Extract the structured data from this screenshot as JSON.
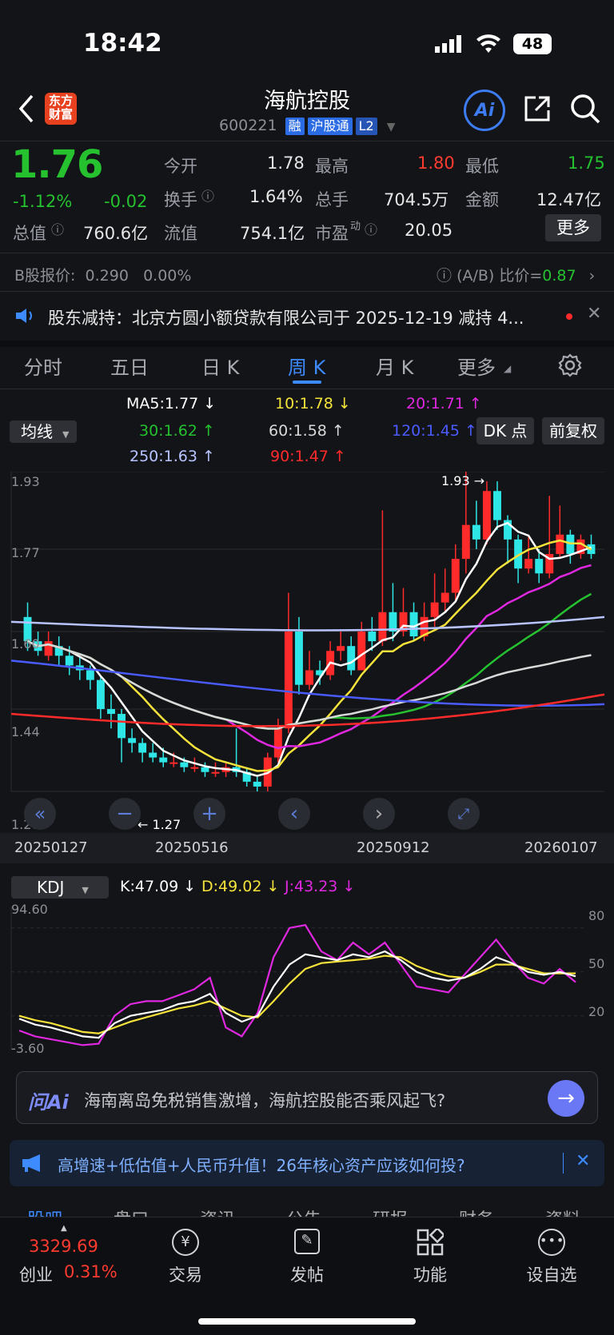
{
  "status_bar": {
    "time": "18:42",
    "battery": "48"
  },
  "header": {
    "logo_text": [
      "东方",
      "财富"
    ],
    "stock_name": "海航控股",
    "stock_code": "600221",
    "tags": [
      "融",
      "沪股通",
      "L2"
    ],
    "ai_label": "Ai"
  },
  "quote": {
    "price": "1.76",
    "change_pct": "-1.12%",
    "change": "-0.02",
    "fields": {
      "open_label": "今开",
      "open": "1.78",
      "high_label": "最高",
      "high": "1.80",
      "low_label": "最低",
      "low": "1.75",
      "turnover_label": "换手",
      "turnover": "1.64%",
      "volume_label": "总手",
      "volume": "704.5万",
      "amount_label": "金额",
      "amount": "12.47亿",
      "total_cap_label": "总值",
      "total_cap": "760.6亿",
      "float_cap_label": "流值",
      "float_cap": "754.1亿",
      "pe_label": "市盈",
      "pe_sup": "动",
      "pe": "20.05"
    },
    "more_label": "更多",
    "b_share_label": "B股报价:",
    "b_share_price": "0.290",
    "b_share_pct": "0.00%",
    "ab_ratio_label": "(A/B) 比价=",
    "ab_ratio": "0.87"
  },
  "announcement": {
    "text": "股东减持：北京方圆小额贷款有限公司于 2025-12-19 减持 4..."
  },
  "tabs": [
    {
      "label": "分时"
    },
    {
      "label": "五日"
    },
    {
      "label": "日 K"
    },
    {
      "label": "周 K"
    },
    {
      "label": "月 K"
    },
    {
      "label": "更多"
    }
  ],
  "legend": {
    "ma_select": "均线",
    "ma5": "MA5:1.77 ↓",
    "ma10": "10:1.78 ↓",
    "ma20": "20:1.71 ↑",
    "ma30": "30:1.62 ↑",
    "ma60": "60:1.58 ↑",
    "ma120": "120:1.45 ↑",
    "ma250": "250:1.63 ↑",
    "ma90": "90:1.47 ↑",
    "dk_btn": "DK 点",
    "fq_btn": "前复权",
    "colors": {
      "ma5": "#ffffff",
      "ma10": "#f5e33b",
      "ma20": "#e028e0",
      "ma30": "#25c12f",
      "ma60": "#d9d9d9",
      "ma120": "#4a5bff",
      "ma250": "#b8c4ff",
      "ma90": "#ff2b2b"
    }
  },
  "chart_data": [
    {
      "type": "candlestick",
      "title": "",
      "y_ticks": [
        "1.93",
        "1.77",
        "1.60",
        "1.44",
        "1.27"
      ],
      "ylim": [
        1.27,
        1.93
      ],
      "x_ticks": [
        "20250127",
        "20250516",
        "20250912",
        "20260107"
      ],
      "annotations": {
        "max": "1.93",
        "min": "1.27"
      },
      "candles": [
        {
          "o": 1.63,
          "c": 1.58,
          "h": 1.66,
          "l": 1.56
        },
        {
          "o": 1.58,
          "c": 1.56,
          "h": 1.6,
          "l": 1.55
        },
        {
          "o": 1.55,
          "c": 1.58,
          "h": 1.6,
          "l": 1.54
        },
        {
          "o": 1.57,
          "c": 1.55,
          "h": 1.59,
          "l": 1.53
        },
        {
          "o": 1.55,
          "c": 1.53,
          "h": 1.57,
          "l": 1.51
        },
        {
          "o": 1.53,
          "c": 1.52,
          "h": 1.55,
          "l": 1.5
        },
        {
          "o": 1.52,
          "c": 1.5,
          "h": 1.53,
          "l": 1.48
        },
        {
          "o": 1.5,
          "c": 1.44,
          "h": 1.51,
          "l": 1.42
        },
        {
          "o": 1.44,
          "c": 1.43,
          "h": 1.47,
          "l": 1.4
        },
        {
          "o": 1.43,
          "c": 1.38,
          "h": 1.44,
          "l": 1.33
        },
        {
          "o": 1.38,
          "c": 1.37,
          "h": 1.4,
          "l": 1.35
        },
        {
          "o": 1.37,
          "c": 1.35,
          "h": 1.38,
          "l": 1.33
        },
        {
          "o": 1.35,
          "c": 1.34,
          "h": 1.37,
          "l": 1.33
        },
        {
          "o": 1.34,
          "c": 1.33,
          "h": 1.36,
          "l": 1.32
        },
        {
          "o": 1.33,
          "c": 1.33,
          "h": 1.35,
          "l": 1.32
        },
        {
          "o": 1.33,
          "c": 1.32,
          "h": 1.34,
          "l": 1.31
        },
        {
          "o": 1.32,
          "c": 1.32,
          "h": 1.34,
          "l": 1.31
        },
        {
          "o": 1.32,
          "c": 1.31,
          "h": 1.33,
          "l": 1.3
        },
        {
          "o": 1.31,
          "c": 1.31,
          "h": 1.33,
          "l": 1.3
        },
        {
          "o": 1.31,
          "c": 1.32,
          "h": 1.33,
          "l": 1.3
        },
        {
          "o": 1.32,
          "c": 1.31,
          "h": 1.4,
          "l": 1.3
        },
        {
          "o": 1.31,
          "c": 1.29,
          "h": 1.32,
          "l": 1.28
        },
        {
          "o": 1.29,
          "c": 1.28,
          "h": 1.3,
          "l": 1.27
        },
        {
          "o": 1.28,
          "c": 1.34,
          "h": 1.35,
          "l": 1.27
        },
        {
          "o": 1.34,
          "c": 1.4,
          "h": 1.42,
          "l": 1.33
        },
        {
          "o": 1.4,
          "c": 1.6,
          "h": 1.68,
          "l": 1.39
        },
        {
          "o": 1.6,
          "c": 1.49,
          "h": 1.63,
          "l": 1.47
        },
        {
          "o": 1.49,
          "c": 1.52,
          "h": 1.56,
          "l": 1.48
        },
        {
          "o": 1.52,
          "c": 1.51,
          "h": 1.54,
          "l": 1.49
        },
        {
          "o": 1.51,
          "c": 1.56,
          "h": 1.58,
          "l": 1.5
        },
        {
          "o": 1.56,
          "c": 1.57,
          "h": 1.6,
          "l": 1.54
        },
        {
          "o": 1.57,
          "c": 1.52,
          "h": 1.59,
          "l": 1.51
        },
        {
          "o": 1.52,
          "c": 1.6,
          "h": 1.62,
          "l": 1.52
        },
        {
          "o": 1.6,
          "c": 1.58,
          "h": 1.63,
          "l": 1.56
        },
        {
          "o": 1.58,
          "c": 1.64,
          "h": 1.85,
          "l": 1.57
        },
        {
          "o": 1.64,
          "c": 1.6,
          "h": 1.7,
          "l": 1.58
        },
        {
          "o": 1.6,
          "c": 1.64,
          "h": 1.69,
          "l": 1.59
        },
        {
          "o": 1.64,
          "c": 1.59,
          "h": 1.66,
          "l": 1.58
        },
        {
          "o": 1.59,
          "c": 1.63,
          "h": 1.66,
          "l": 1.58
        },
        {
          "o": 1.63,
          "c": 1.66,
          "h": 1.72,
          "l": 1.61
        },
        {
          "o": 1.66,
          "c": 1.68,
          "h": 1.73,
          "l": 1.64
        },
        {
          "o": 1.68,
          "c": 1.75,
          "h": 1.78,
          "l": 1.66
        },
        {
          "o": 1.75,
          "c": 1.82,
          "h": 1.93,
          "l": 1.72
        },
        {
          "o": 1.82,
          "c": 1.79,
          "h": 1.87,
          "l": 1.77
        },
        {
          "o": 1.79,
          "c": 1.89,
          "h": 1.91,
          "l": 1.78
        },
        {
          "o": 1.89,
          "c": 1.83,
          "h": 1.91,
          "l": 1.81
        },
        {
          "o": 1.83,
          "c": 1.79,
          "h": 1.84,
          "l": 1.74
        },
        {
          "o": 1.79,
          "c": 1.73,
          "h": 1.8,
          "l": 1.7
        },
        {
          "o": 1.73,
          "c": 1.75,
          "h": 1.8,
          "l": 1.72
        },
        {
          "o": 1.75,
          "c": 1.72,
          "h": 1.77,
          "l": 1.7
        },
        {
          "o": 1.72,
          "c": 1.76,
          "h": 1.88,
          "l": 1.71
        },
        {
          "o": 1.76,
          "c": 1.8,
          "h": 1.86,
          "l": 1.75
        },
        {
          "o": 1.8,
          "c": 1.76,
          "h": 1.81,
          "l": 1.74
        },
        {
          "o": 1.76,
          "c": 1.79,
          "h": 1.8,
          "l": 1.75
        },
        {
          "o": 1.78,
          "c": 1.76,
          "h": 1.8,
          "l": 1.75
        }
      ]
    },
    {
      "type": "line",
      "title": "KDJ",
      "series_values_label": {
        "k": "K:47.09 ↓",
        "d": "D:49.02 ↓",
        "j": "J:43.23 ↓"
      },
      "y_ticks": [
        "94.60",
        "-3.60"
      ],
      "right_ticks": [
        "80",
        "50",
        "20"
      ],
      "ylim": [
        -3.6,
        94.6
      ],
      "series": [
        {
          "name": "K",
          "color": "#ffffff",
          "values": [
            18,
            14,
            12,
            9,
            6,
            5,
            15,
            20,
            22,
            24,
            28,
            30,
            35,
            22,
            16,
            20,
            40,
            55,
            62,
            60,
            58,
            62,
            60,
            64,
            58,
            50,
            46,
            44,
            46,
            52,
            60,
            56,
            50,
            48,
            50,
            47
          ]
        },
        {
          "name": "D",
          "color": "#f5e33b",
          "values": [
            20,
            17,
            15,
            12,
            9,
            8,
            12,
            16,
            19,
            22,
            25,
            27,
            30,
            25,
            20,
            19,
            30,
            42,
            52,
            56,
            57,
            58,
            59,
            61,
            60,
            54,
            50,
            47,
            46,
            50,
            55,
            55,
            52,
            49,
            49,
            49
          ]
        },
        {
          "name": "J",
          "color": "#e028e0",
          "values": [
            10,
            6,
            4,
            2,
            0,
            1,
            20,
            28,
            30,
            30,
            34,
            38,
            46,
            12,
            6,
            22,
            60,
            80,
            82,
            64,
            58,
            70,
            62,
            70,
            55,
            40,
            38,
            36,
            48,
            60,
            72,
            58,
            46,
            42,
            52,
            43
          ]
        }
      ]
    }
  ],
  "nav_buttons": {
    "left": "«",
    "minus": "−",
    "plus": "+",
    "prev": "‹",
    "next": "›"
  },
  "ai_question": {
    "logo": "问Ai",
    "text": "海南离岛免税销售激增，海航控股能否乘风起飞?"
  },
  "news_bar": {
    "text": "高增速+低估值+人民币升值！26年核心资产应该如何投?"
  },
  "sub_tabs": [
    "股吧",
    "盘口",
    "资讯",
    "公告",
    "研报",
    "财务",
    "资料"
  ],
  "bottom_nav": {
    "index_value": "3329.69",
    "index_name": "创业",
    "index_pct": "0.31%",
    "trade": "交易",
    "post": "发帖",
    "func": "功能",
    "watch": "设自选"
  }
}
